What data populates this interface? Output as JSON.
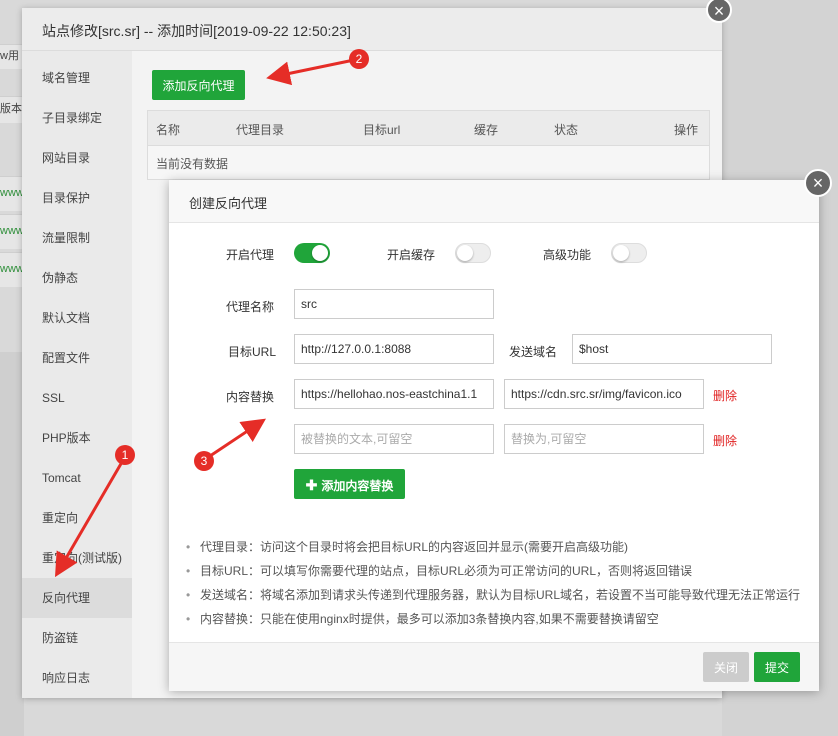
{
  "background": {
    "fragments": [
      "w用",
      "版本",
      "www",
      "www",
      "www"
    ]
  },
  "outer_dialog": {
    "title": "站点修改[src.sr] -- 添加时间[2019-09-22 12:50:23]",
    "close_icon": "×",
    "sidebar": [
      {
        "label": "域名管理"
      },
      {
        "label": "子目录绑定"
      },
      {
        "label": "网站目录"
      },
      {
        "label": "目录保护"
      },
      {
        "label": "流量限制"
      },
      {
        "label": "伪静态"
      },
      {
        "label": "默认文档"
      },
      {
        "label": "配置文件"
      },
      {
        "label": "SSL"
      },
      {
        "label": "PHP版本"
      },
      {
        "label": "Tomcat"
      },
      {
        "label": "重定向"
      },
      {
        "label": "重定向(测试版)"
      },
      {
        "label": "反向代理"
      },
      {
        "label": "防盗链"
      },
      {
        "label": "响应日志"
      }
    ],
    "add_button": "添加反向代理",
    "table": {
      "columns": [
        "名称",
        "代理目录",
        "目标url",
        "缓存",
        "状态",
        "操作"
      ],
      "empty_text": "当前没有数据"
    }
  },
  "inner_dialog": {
    "title": "创建反向代理",
    "close_icon": "×",
    "toggles": [
      {
        "label": "开启代理",
        "on": true
      },
      {
        "label": "开启缓存",
        "on": false
      },
      {
        "label": "高级功能",
        "on": false
      }
    ],
    "proxy_name": {
      "label": "代理名称",
      "value": "src"
    },
    "target_url": {
      "label": "目标URL",
      "value": "http://127.0.0.1:8088"
    },
    "send_domain": {
      "label": "发送域名",
      "value": "$host"
    },
    "content_replace": {
      "label": "内容替换",
      "rows": [
        {
          "find": "https://hellohao.nos-eastchina1.1",
          "replace": "https://cdn.src.sr/img/favicon.ico",
          "delete": "删除"
        },
        {
          "find_placeholder": "被替换的文本,可留空",
          "replace_placeholder": "替换为,可留空",
          "delete": "删除"
        }
      ]
    },
    "add_replace_button": "添加内容替换",
    "notes": [
      "代理目录：访问这个目录时将会把目标URL的内容返回并显示(需要开启高级功能)",
      "目标URL：可以填写你需要代理的站点，目标URL必须为可正常访问的URL，否则将返回错误",
      "发送域名：将域名添加到请求头传递到代理服务器，默认为目标URL域名，若设置不当可能导致代理无法正常运行",
      "内容替换：只能在使用nginx时提供，最多可以添加3条替换内容,如果不需要替换请留空"
    ],
    "close_button": "关闭",
    "submit_button": "提交"
  },
  "annotations": {
    "badges": [
      "1",
      "2",
      "3"
    ],
    "color": "#e52d27"
  },
  "colors": {
    "accent": "#20a53a",
    "danger": "#e02020"
  }
}
